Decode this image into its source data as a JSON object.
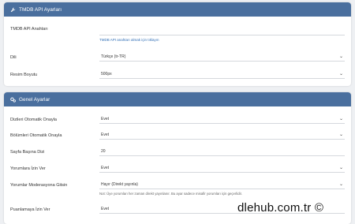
{
  "api_panel": {
    "title": "TMDB API Ayarları",
    "api_key_label": "TMDB API Anahtarı",
    "api_key_value": "",
    "api_key_link": "TMDB API anahtarı almak için tıklayın",
    "language_label": "Dili",
    "language_value": "Türkçe (tr-TR)",
    "image_size_label": "Resim Boyutu",
    "image_size_value": "500px"
  },
  "general_panel": {
    "title": "Genel Ayarlar",
    "series_auto_label": "Dizileri Otomatik Onayla",
    "series_auto_value": "Evet",
    "episodes_auto_label": "Bölümleri Otomatik Onayla",
    "episodes_auto_value": "Evet",
    "per_page_label": "Sayfa Başına Dizi",
    "per_page_value": "20",
    "comments_label": "Yorumlara İzin Ver",
    "comments_value": "Evet",
    "moderation_label": "Yorumlar Moderasyona Gitsin",
    "moderation_value": "Hayır (Direkt yayınla)",
    "moderation_note": "Not: Üye yorumları her zaman direkt yayınlanır. Bu ayar sadece misafir yorumları için geçerlidir.",
    "rating_label": "Puanlamaya İzin Ver",
    "rating_value": "Evet"
  },
  "watermark": "dlehub.com.tr ©"
}
